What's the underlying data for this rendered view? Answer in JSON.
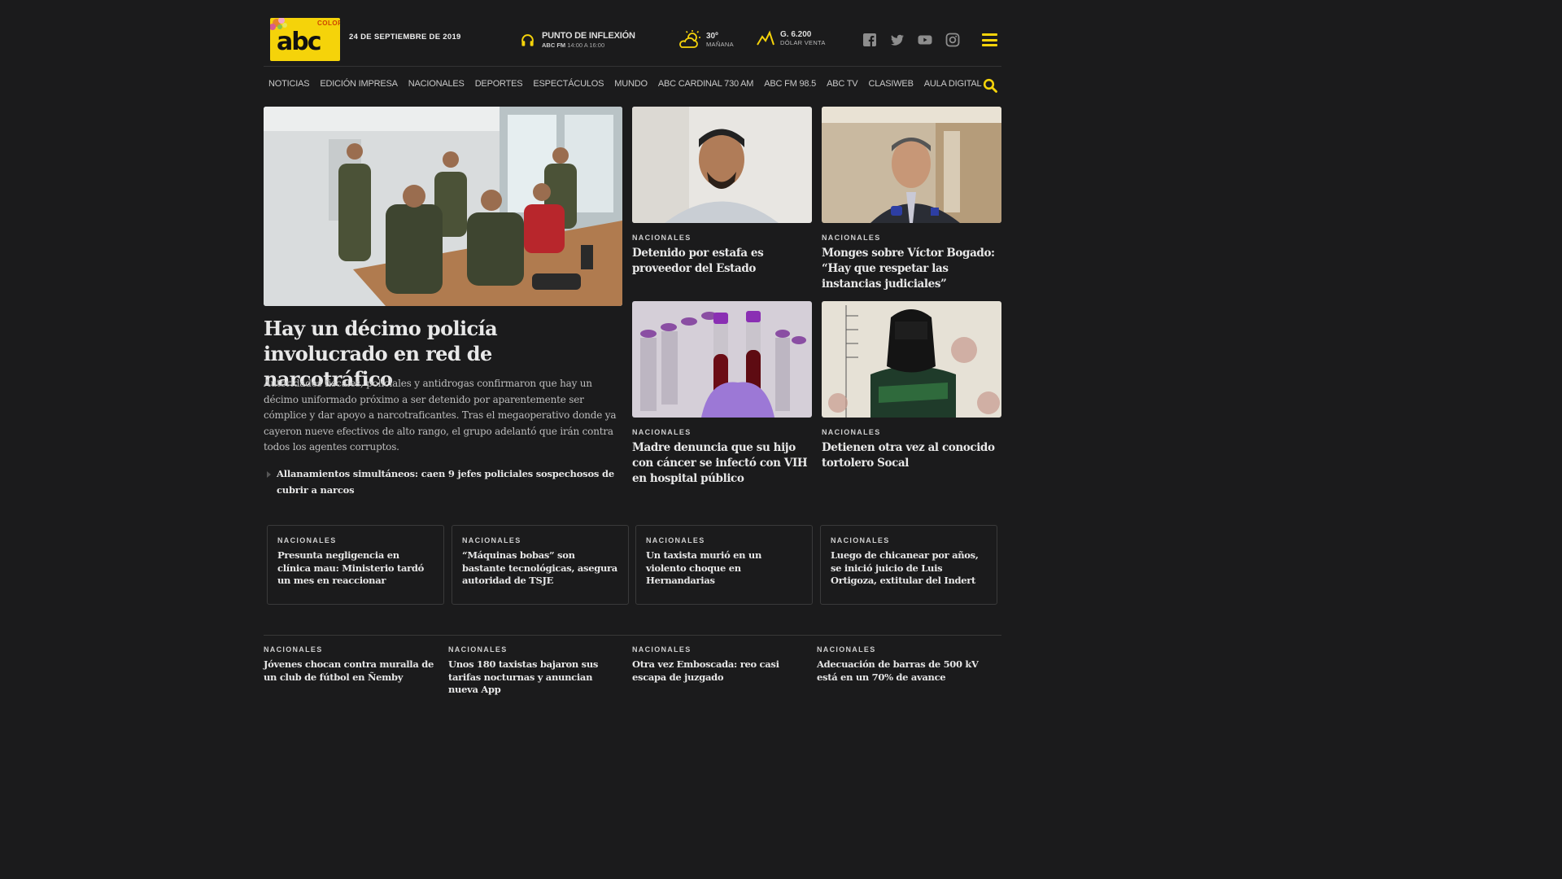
{
  "header": {
    "logo_text": "abc",
    "logo_tag": "COLOR",
    "date": "24 DE SEPTIEMBRE DE 2019",
    "radio": {
      "title": "PUNTO DE INFLEXIÓN",
      "station": "ABC FM",
      "schedule": "14:00 A 16:00",
      "icon": "headphones-icon"
    },
    "weather": {
      "temp": "30º",
      "period": "MAÑANA",
      "icon": "sun-cloud-icon"
    },
    "dollar": {
      "value": "G. 6.200",
      "label": "DÓLAR VENTA",
      "icon": "trend-icon"
    },
    "socials": [
      "facebook-icon",
      "twitter-icon",
      "youtube-icon",
      "instagram-icon"
    ]
  },
  "nav": {
    "items": [
      "NOTICIAS",
      "EDICIÓN IMPRESA",
      "NACIONALES",
      "DEPORTES",
      "ESPECTÁCULOS",
      "MUNDO",
      "ABC CARDINAL 730 AM",
      "ABC FM 98.5",
      "ABC TV",
      "CLASIWEB",
      "AULA DIGITAL"
    ]
  },
  "main": {
    "title": "Hay un décimo policía involucrado en red de narcotráfico",
    "description": "Autoridades fiscales, policiales y antidrogas confirmaron que hay un décimo uniformado próximo a ser detenido por aparentemente ser cómplice y dar apoyo a narcotraficantes. Tras el megaoperativo donde ya cayeron nueve efectivos de alto rango, el grupo adelantó que irán contra todos los agentes corruptos.",
    "related": "Allanamientos simultáneos: caen 9 jefes policiales sospechosos de cubrir a narcos"
  },
  "side": [
    {
      "kicker": "NACIONALES",
      "title": "Detenido por estafa es proveedor del Estado"
    },
    {
      "kicker": "NACIONALES",
      "title": "Monges sobre Víctor Bogado: “Hay que respetar las instancias judiciales”"
    },
    {
      "kicker": "NACIONALES",
      "title": "Madre denuncia que su hijo con cáncer se infectó con VIH en hospital público"
    },
    {
      "kicker": "NACIONALES",
      "title": "Detienen otra vez al conocido tortolero Socal"
    }
  ],
  "boxes": [
    {
      "kicker": "NACIONALES",
      "title": "Presunta negligencia en clínica mau: Ministerio tardó un mes en reaccionar"
    },
    {
      "kicker": "NACIONALES",
      "title": "“Máquinas bobas” son bastante tecnológicas, asegura autoridad de TSJE"
    },
    {
      "kicker": "NACIONALES",
      "title": "Un taxista murió en un violento choque en Hernandarias"
    },
    {
      "kicker": "NACIONALES",
      "title": "Luego de chicanear por años, se inició juicio de Luis Ortigoza, extitular del Indert"
    }
  ],
  "bottom": [
    {
      "kicker": "NACIONALES",
      "title": "Jóvenes chocan contra muralla de un club de fútbol en Ñemby"
    },
    {
      "kicker": "NACIONALES",
      "title": "Unos 180 taxistas bajaron sus tarifas nocturnas y anuncian nueva App"
    },
    {
      "kicker": "NACIONALES",
      "title": "Otra vez Emboscada: reo casi escapa de juzgado"
    },
    {
      "kicker": "NACIONALES",
      "title": "Adecuación de barras de 500 kV está en un 70% de avance"
    }
  ],
  "colors": {
    "background": "#1b1b1c",
    "accent": "#f5d30a"
  }
}
